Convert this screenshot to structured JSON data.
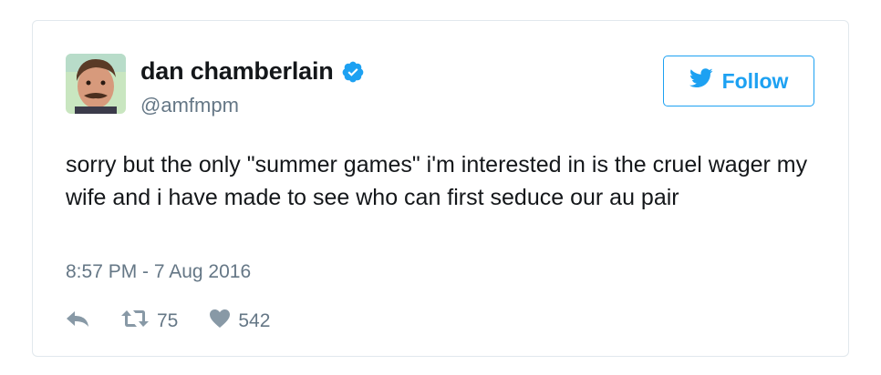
{
  "author": {
    "display_name": "dan chamberlain",
    "handle": "@amfmpm",
    "verified_icon": "verified-badge-icon",
    "avatar_icon": "avatar"
  },
  "follow_button": {
    "label": "Follow",
    "icon": "twitter-bird-icon"
  },
  "tweet": {
    "text": "sorry but the only \"summer games\" i'm interested in is the cruel wager my wife and i have made to see who can first seduce our au pair",
    "timestamp": "8:57 PM - 7 Aug 2016"
  },
  "actions": {
    "reply_icon": "reply-icon",
    "retweet_icon": "retweet-icon",
    "retweet_count": "75",
    "like_icon": "heart-icon",
    "like_count": "542"
  },
  "colors": {
    "accent": "#1da1f2",
    "verified": "#1da1f2",
    "muted_text": "#657786",
    "border": "#e1e8ed"
  }
}
